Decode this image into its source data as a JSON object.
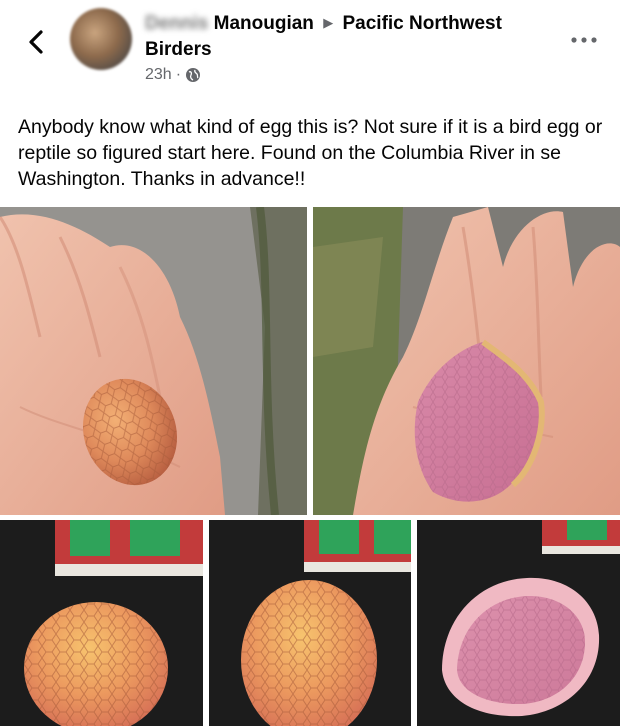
{
  "header": {
    "author_blurred": "Dennis",
    "author_last": "Manougian",
    "group": "Pacific Northwest Birders",
    "time": "23h",
    "separator": "·",
    "icons": [
      "back-chevron-icon",
      "globe-icon",
      "more-dots-icon"
    ]
  },
  "post": {
    "text": "Anybody know what kind of egg this is?  Not sure if it is a bird egg or reptile so figured start here.  Found on the Columbia River in  se Washington.  Thanks in advance!!"
  },
  "photos": [
    {
      "subject": "whole egg in palm"
    },
    {
      "subject": "broken eggshell in palm"
    },
    {
      "subject": "egg close-up"
    },
    {
      "subject": "egg close-up"
    },
    {
      "subject": "eggshell half"
    }
  ],
  "colors": {
    "text": "#050505",
    "meta": "#65676b",
    "egg": "#e6925c",
    "shell_pink": "#e7a3b9"
  }
}
